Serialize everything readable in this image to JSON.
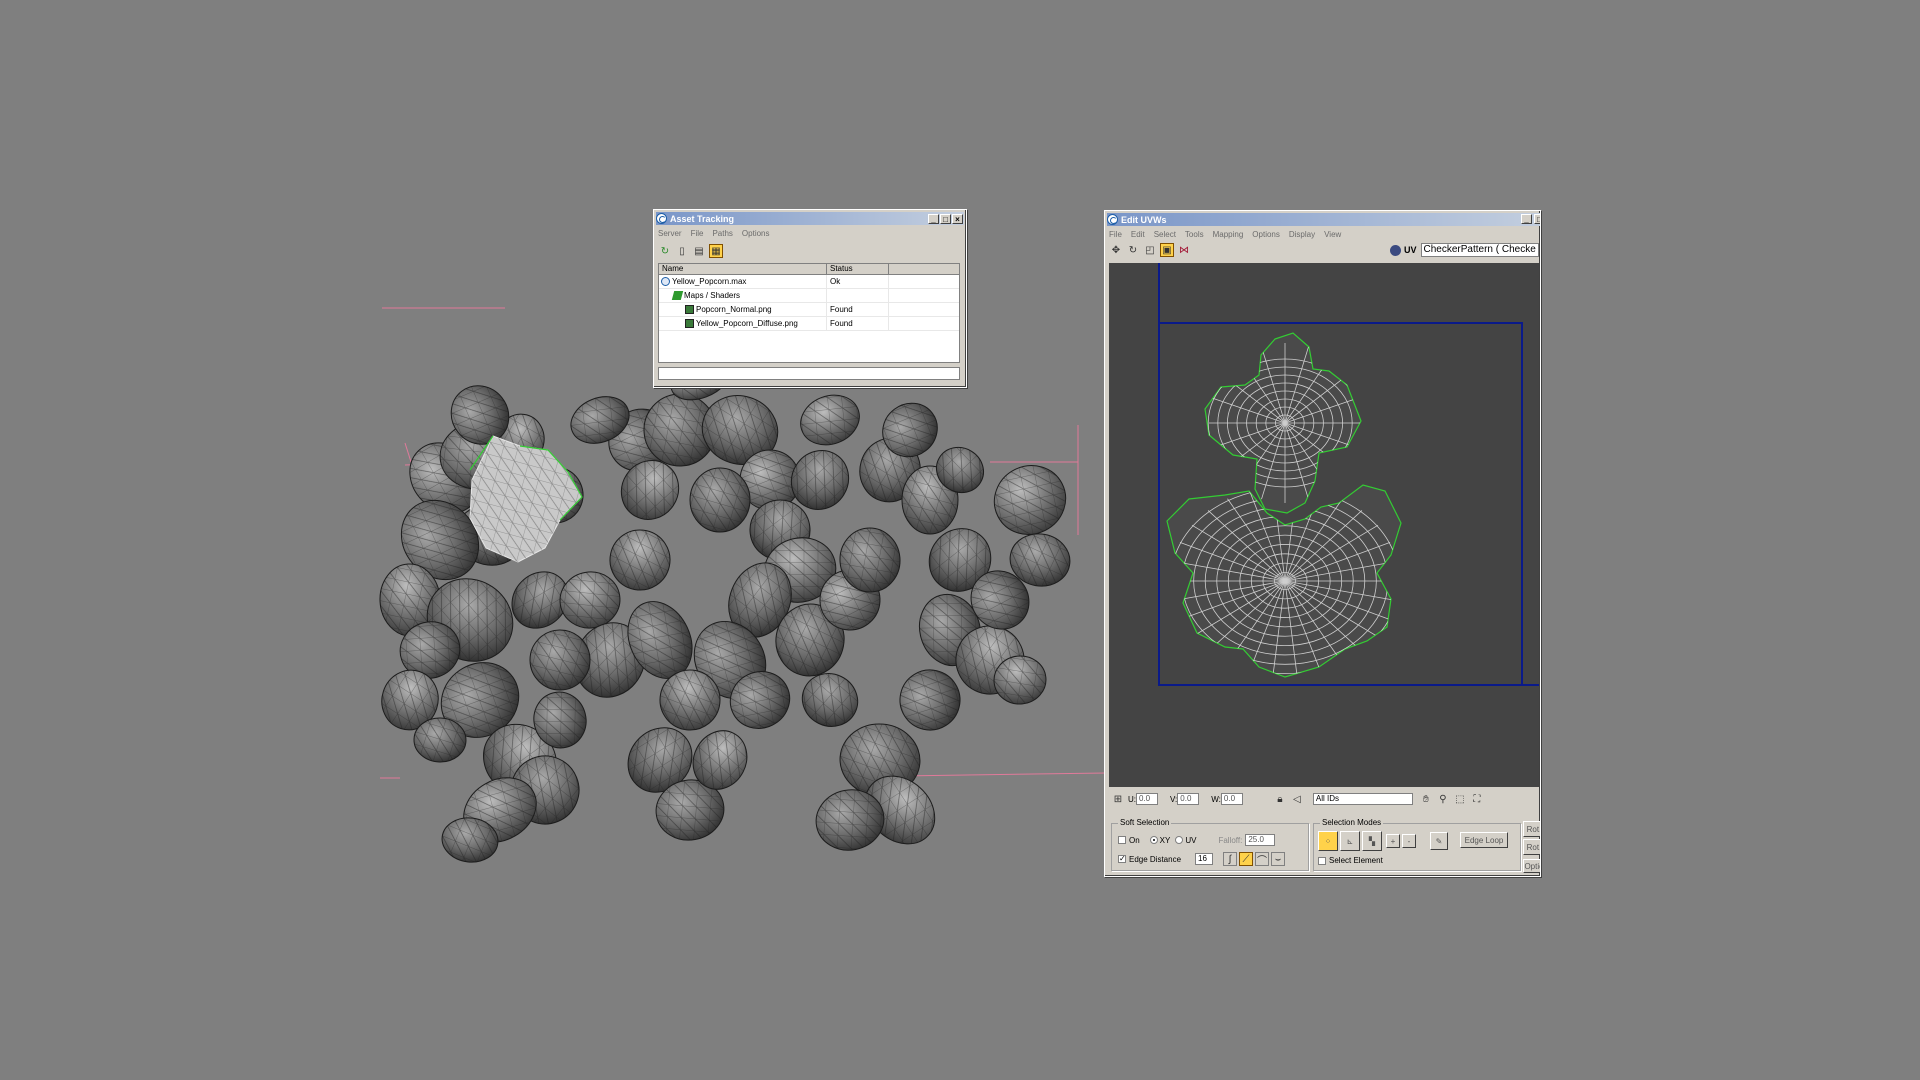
{
  "asset_tracking": {
    "title": "Asset Tracking",
    "menu": [
      "Server",
      "File",
      "Paths",
      "Options"
    ],
    "columns": [
      "Name",
      "Status"
    ],
    "rows": [
      {
        "name": "Yellow_Popcorn.max",
        "status": "Ok"
      },
      {
        "name": "Maps / Shaders",
        "status": ""
      },
      {
        "name": "Popcorn_Normal.png",
        "status": "Found"
      },
      {
        "name": "Yellow_Popcorn_Diffuse.png",
        "status": "Found"
      }
    ]
  },
  "edit_uvws": {
    "title": "Edit UVWs",
    "menu": [
      "File",
      "Edit",
      "Select",
      "Tools",
      "Mapping",
      "Options",
      "Display",
      "View"
    ],
    "uv_label": "UV",
    "texture_dropdown": "CheckerPattern  ( Checke",
    "coords": {
      "u_label": "U:",
      "u": "0.0",
      "v_label": "V:",
      "v": "0.0",
      "w_label": "W:",
      "w": "0.0"
    },
    "id_dropdown": "All IDs",
    "soft_selection": {
      "title": "Soft Selection",
      "on_label": "On",
      "xy_label": "XY",
      "uv_label": "UV",
      "falloff_label": "Falloff:",
      "falloff_value": "25.0",
      "edge_distance_label": "Edge Distance",
      "edge_distance_value": "16"
    },
    "selection_modes": {
      "title": "Selection Modes",
      "plus": "+",
      "minus": "-",
      "edge_loop": "Edge Loop",
      "select_element": "Select Element"
    },
    "side_buttons": [
      "Rot.",
      "Rot.",
      "Optio"
    ]
  },
  "colors": {
    "background": "#7f7f7f",
    "title_active": "#0a246a",
    "title_inactive": "#7a96c8",
    "uv_bg": "#444444",
    "uv_border": "#0a1a8a",
    "uv_selected": "#33cc33",
    "trajectory": "#e07a9a"
  },
  "icons": [
    "max-logo-icon",
    "refresh-icon",
    "checkout-icon",
    "grid-view-icon",
    "move-icon",
    "rotate-icon",
    "scale-icon",
    "freeform-icon",
    "mirror-icon",
    "hand-pan-icon",
    "zoom-icon"
  ]
}
